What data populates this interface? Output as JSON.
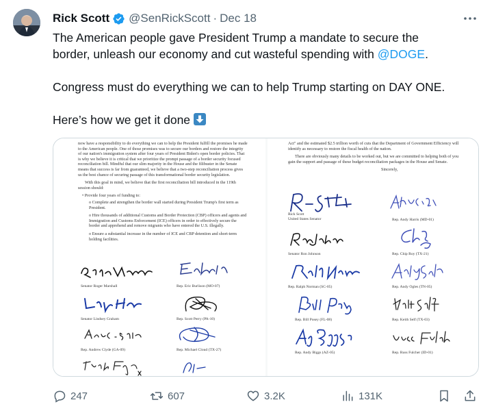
{
  "author": {
    "name": "Rick Scott",
    "handle": "@SenRickScott",
    "separator": "·",
    "date": "Dec 18"
  },
  "tweet": {
    "line1": "The American people gave President Trump a mandate to secure the",
    "line2_prefix": "border, unleash our economy and cut wasteful spending with ",
    "line2_mention": "@DOGE",
    "line2_suffix": ".",
    "para2": "Congress must do everything we can to help Trump starting on DAY ONE.",
    "para3": "Here’s how we get it done",
    "emoji_icon": "down-arrow-emoji"
  },
  "letter": {
    "left_body": [
      "now have a responsibility to do everything we can to help the President fulfill the promises he made to the American people. One of those promises was to secure our borders and restore the integrity of our nation's immigration system after four years of President Biden's open border policies. That is why we believe it is critical that we prioritize the prompt passage of a border security focused reconciliation bill. Mindful that our slim majority in the House and the filibuster in the Senate means that success is far from guaranteed, we believe that a two-step reconciliation process gives us the best chance of securing passage of this transformational border security legislation.",
      "With this goal in mind, we believe that the first reconciliation bill introduced in the 119th session should:"
    ],
    "bullet": "Provide four years of funding to:",
    "sub_bullets": [
      "Complete and strengthen the border wall started during President Trump's first term as President.",
      "Hire thousands of additional Customs and Border Protection (CBP) officers and agents and Immigration and Customs Enforcement (ICE) officers in order to effectively secure the border and apprehend and remove migrants who have entered the U.S. illegally.",
      "Ensure a substantial increase in the number of ICE and CBP detention and short-term holding facilities."
    ],
    "right_body": [
      "Act\" and the estimated $2.5 trillion worth of cuts that the Department of Government Efficiency will identify as necessary to restore the fiscal health of the nation.",
      "There are obviously many details to be worked out, but we are committed to helping both of you gain the support and passage of these budget reconciliation packages in the House and Senate."
    ],
    "closing": "Sincerely,",
    "left_signatures": [
      {
        "label": "Senator Roger Marshall"
      },
      {
        "label": "Rep. Eric Burlison (MO-07)"
      },
      {
        "label": "Senator Lindsey Graham"
      },
      {
        "label": "Rep. Scott Perry (PA-10)"
      },
      {
        "label": "Rep. Andrew Clyde (GA-09)"
      },
      {
        "label": "Rep. Michael Cloud (TX-27)"
      }
    ],
    "right_signatures": [
      {
        "label1": "Rick Scott",
        "label2": "United States Senator"
      },
      {
        "label1": "Rep. Andy Harris (MD-01)"
      },
      {
        "label1": "Senator Ron Johnson"
      },
      {
        "label1": "Rep. Chip Roy (TX-21)"
      },
      {
        "label1": "Rep. Ralph Norman (SC-05)"
      },
      {
        "label1": "Rep. Andy Ogles (TN-05)"
      },
      {
        "label1": "Rep. Bill Posey (FL-08)"
      },
      {
        "label1": "Rep. Keith Self (TX-03)"
      },
      {
        "label1": "Rep. Andy Biggs (AZ-05)"
      },
      {
        "label1": "Rep. Russ Fulcher (ID-01)"
      }
    ]
  },
  "actions": {
    "replies": "247",
    "reposts": "607",
    "likes": "3.2K",
    "views": "131K"
  },
  "colors": {
    "text": "#0f1419",
    "secondary": "#536471",
    "link": "#1d9bf0",
    "verified": "#1d9bf0",
    "border": "#cfd9de"
  }
}
